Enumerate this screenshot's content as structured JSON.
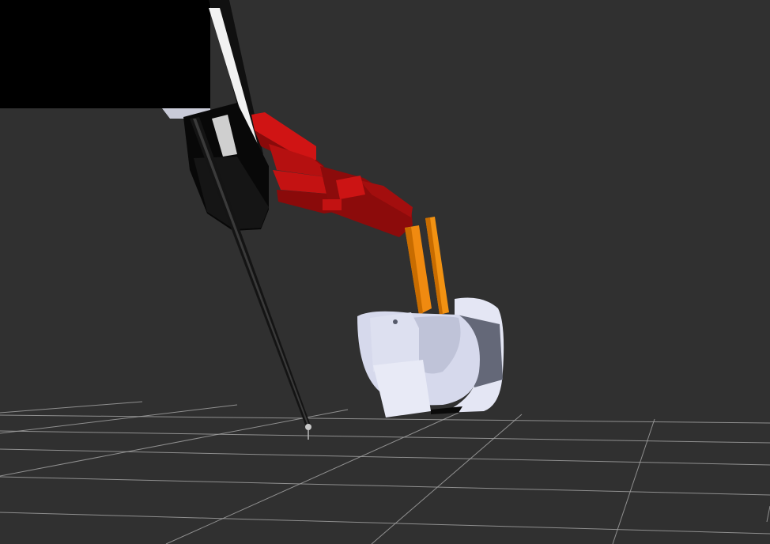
{
  "viewport": {
    "background_color": "#303030",
    "grid_color": "#a0a0a0"
  },
  "scene": {
    "objects": [
      {
        "name": "robot-arm-base-block",
        "color": "#000000"
      },
      {
        "name": "red-parallel-linkage-arm",
        "color": "#b01010"
      },
      {
        "name": "orange-wrist-links",
        "color": "#f08000"
      },
      {
        "name": "grey-spherical-wrist-housing",
        "color": "#d0d4e8"
      },
      {
        "name": "black-instrument-shaft",
        "color": "#1a1a1a"
      },
      {
        "name": "instrument-tip",
        "color": "#c8c8c8"
      }
    ]
  }
}
